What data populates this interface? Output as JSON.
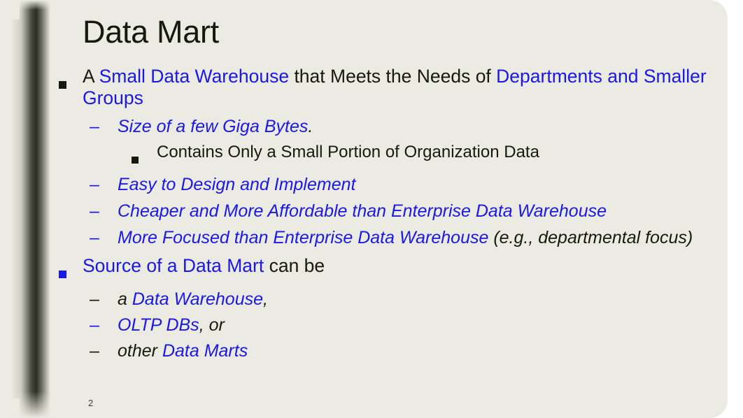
{
  "slide": {
    "title": "Data Mart",
    "page_number": "2",
    "colors": {
      "background": "#ecebe3",
      "accent_blue": "#1a18e8",
      "text_black": "#17190f",
      "stripe_dark": "#2c2e24"
    }
  },
  "bullets": {
    "b1": {
      "marker": "square-black",
      "parts": [
        {
          "text": "A ",
          "color": "black",
          "italic": false
        },
        {
          "text": "Small Data Warehouse",
          "color": "blue",
          "italic": false
        },
        {
          "text": " that Meets the Needs of ",
          "color": "black",
          "italic": false
        },
        {
          "text": "Departments and Smaller Groups",
          "color": "blue",
          "italic": false
        }
      ]
    },
    "b1s1": {
      "marker": "dash-blue",
      "parts": [
        {
          "text": "Size of a few Giga Bytes",
          "color": "blue",
          "italic": true
        },
        {
          "text": ".",
          "color": "black",
          "italic": true
        }
      ]
    },
    "b1s1s1": {
      "marker": "square-black",
      "parts": [
        {
          "text": "Contains Only a Small Portion of Organization Data",
          "color": "black",
          "italic": false
        }
      ]
    },
    "b1s2": {
      "marker": "dash-blue",
      "parts": [
        {
          "text": "Easy to Design and Implement",
          "color": "blue",
          "italic": true
        }
      ]
    },
    "b1s3": {
      "marker": "dash-blue",
      "parts": [
        {
          "text": "Cheaper and More Affordable than Enterprise Data Warehouse",
          "color": "blue",
          "italic": true
        }
      ]
    },
    "b1s4": {
      "marker": "dash-blue",
      "parts": [
        {
          "text": "More Focused than Enterprise Data Warehouse",
          "color": "blue",
          "italic": true
        },
        {
          "text": " (e.g., departmental focus)",
          "color": "black",
          "italic": true
        }
      ]
    },
    "b2": {
      "marker": "square-blue",
      "parts": [
        {
          "text": "Source of a Data Mart",
          "color": "blue",
          "italic": false
        },
        {
          "text": " can be",
          "color": "black",
          "italic": false
        }
      ]
    },
    "b2s1": {
      "marker": "dash-black",
      "parts": [
        {
          "text": "a ",
          "color": "black",
          "italic": true
        },
        {
          "text": "Data Warehouse",
          "color": "blue",
          "italic": true
        },
        {
          "text": ",",
          "color": "black",
          "italic": true
        }
      ]
    },
    "b2s2": {
      "marker": "dash-blue",
      "parts": [
        {
          "text": "OLTP DBs",
          "color": "blue",
          "italic": true
        },
        {
          "text": ", or",
          "color": "black",
          "italic": true
        }
      ]
    },
    "b2s3": {
      "marker": "dash-black",
      "parts": [
        {
          "text": "other ",
          "color": "black",
          "italic": true
        },
        {
          "text": "Data Marts",
          "color": "blue",
          "italic": true
        }
      ]
    }
  },
  "markers": {
    "dash": "–"
  }
}
